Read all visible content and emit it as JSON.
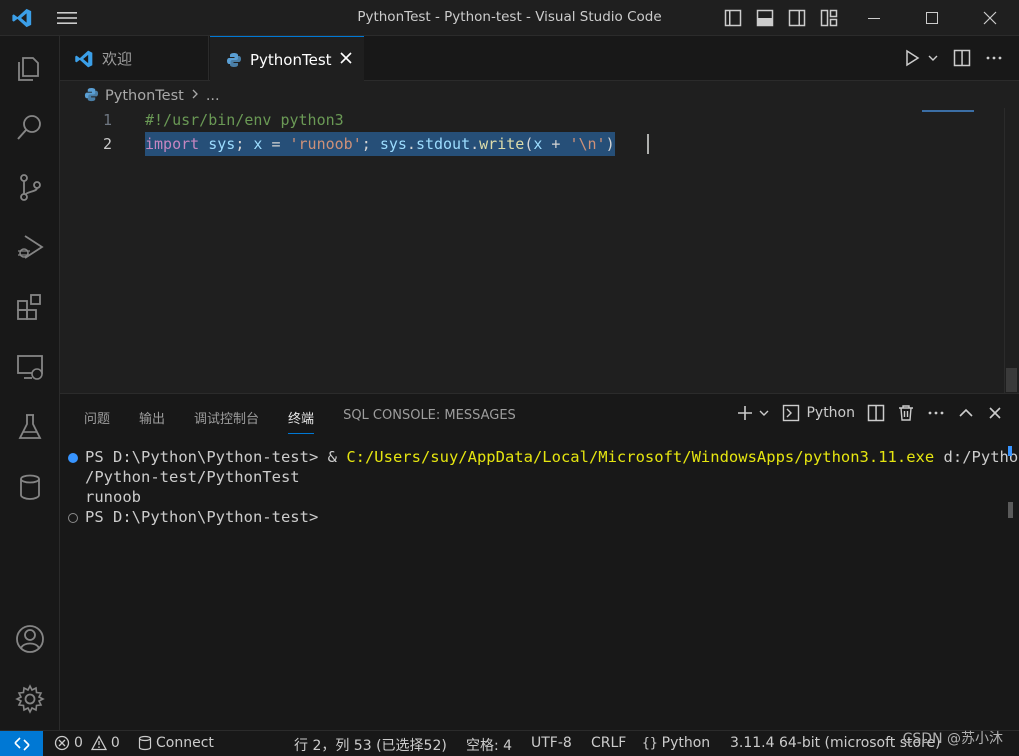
{
  "window": {
    "title": "PythonTest - Python-test - Visual Studio Code"
  },
  "tabs": [
    {
      "label": "欢迎"
    },
    {
      "label": "PythonTest"
    }
  ],
  "breadcrumb": {
    "file": "PythonTest",
    "more": "..."
  },
  "editor": {
    "lines": [
      {
        "number": "1",
        "text": "#!/usr/bin/env python3"
      },
      {
        "number": "2",
        "text": "import sys; x = 'runoob'; sys.stdout.write(x + '\\n')"
      }
    ],
    "tokens": {
      "import": "import",
      "sys": "sys",
      "x": "x",
      "eq": "=",
      "str1": "'runoob'",
      "sys2": "sys",
      "stdout": "stdout",
      "write": "write",
      "x2": "x",
      "plus": "+",
      "str2": "'\\n'"
    }
  },
  "panel": {
    "tabs": [
      "问题",
      "输出",
      "调试控制台",
      "终端",
      "SQL CONSOLE: MESSAGES"
    ],
    "active_tab": "终端",
    "terminal_profile": "Python"
  },
  "terminal": {
    "prompt1": "PS D:\\Python\\Python-test> ",
    "cmd_amp": "& ",
    "cmd_exe": "C:/Users/suy/AppData/Local/Microsoft/WindowsApps/python3.11.exe",
    "cmd_arg": " d:/Python",
    "cmd_arg_cont": "/Python-test/PythonTest",
    "output": "runoob",
    "prompt2": "PS D:\\Python\\Python-test>"
  },
  "statusbar": {
    "errors": "0",
    "warnings": "0",
    "connect": "Connect",
    "position": "行 2，列 53 (已选择52)",
    "spaces": "空格: 4",
    "encoding": "UTF-8",
    "eol": "CRLF",
    "language": "Python",
    "interpreter": "3.11.4 64-bit (microsoft store)"
  },
  "watermark": "CSDN @苏小沐",
  "colors": {
    "accent": "#0078d4",
    "background": "#1f1f1f",
    "selection": "#264f78"
  }
}
